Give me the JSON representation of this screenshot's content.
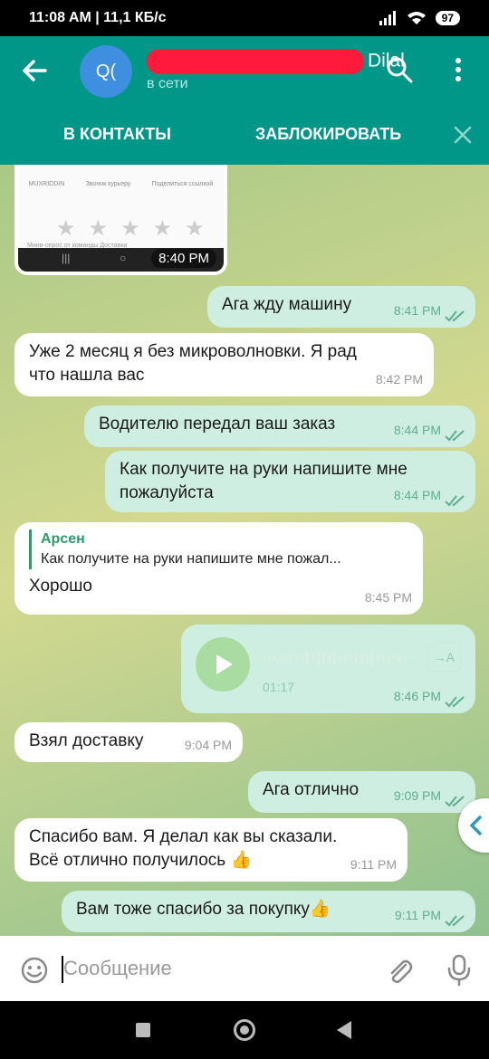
{
  "status_bar": {
    "time": "11:08 AM",
    "network_speed": "11,1 КБ/с",
    "battery": "97"
  },
  "header": {
    "avatar_initials": "Q(",
    "name_visible": "Dilal",
    "status": "в сети"
  },
  "actions": {
    "add_contact": "В КОНТАКТЫ",
    "block": "ЗАБЛОКИРОВАТЬ"
  },
  "image_message": {
    "labels": [
      "MUXRIDDIN",
      "Звонок курьеру",
      "Поделиться ссылкой"
    ],
    "caption": "Мини-опрос от команды Доставки",
    "time": "8:40 PM"
  },
  "messages": [
    {
      "type": "out",
      "text": "Ага жду машину",
      "time": "8:41 PM"
    },
    {
      "type": "in",
      "line1": "Уже 2 месяц я без микроволновки. Я рад",
      "line2": "что нашла вас",
      "time": "8:42 PM"
    },
    {
      "type": "out",
      "text": "Водителю передал ваш заказ",
      "time": "8:44 PM"
    },
    {
      "type": "out",
      "line1": "Как получите на руки напишите мне",
      "line2": "пожалуйста",
      "time": "8:44 PM"
    },
    {
      "type": "in",
      "reply_name": "Арсен",
      "reply_text": "Как получите на руки напишите мне пожал...",
      "text": "Хорошо",
      "time": "8:45 PM"
    },
    {
      "type": "out",
      "voice_duration": "01:17",
      "transcribe": "→A",
      "time": "8:46 PM"
    },
    {
      "type": "in",
      "text": "Взял доставку",
      "time": "9:04 PM"
    },
    {
      "type": "out",
      "text": "Ага отлично",
      "time": "9:09 PM"
    },
    {
      "type": "in",
      "line1": "Спасибо вам. Я делал как вы сказали.",
      "line2": "Всё отлично получилось 👍",
      "time": "9:11 PM"
    },
    {
      "type": "out",
      "text": "Вам тоже спасибо за покупку👍",
      "time": "9:11 PM"
    }
  ],
  "input": {
    "placeholder": "Сообщение"
  },
  "colors": {
    "primary": "#009688",
    "outgoing_bubble": "#cdeee0",
    "incoming_bubble": "#ffffff",
    "accent_green": "#2b9b6a"
  }
}
